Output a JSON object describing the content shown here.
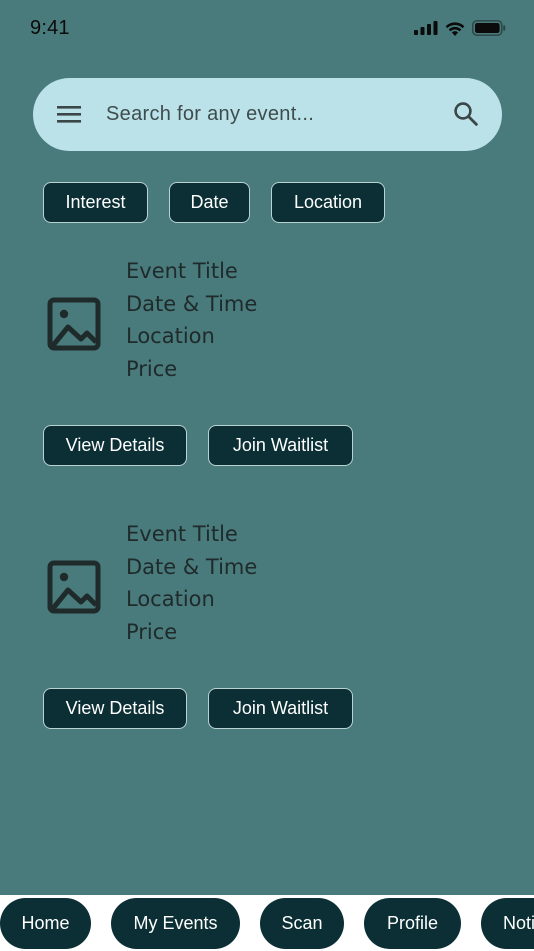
{
  "status_bar": {
    "time": "9:41"
  },
  "search": {
    "placeholder": "Search for any event..."
  },
  "filters": [
    {
      "label": "Interest"
    },
    {
      "label": "Date"
    },
    {
      "label": "Location"
    }
  ],
  "events": [
    {
      "title": "Event Title",
      "datetime": "Date & Time",
      "location": "Location",
      "price": "Price",
      "details_label": "View Details",
      "waitlist_label": "Join Waitlist"
    },
    {
      "title": "Event Title",
      "datetime": "Date & Time",
      "location": "Location",
      "price": "Price",
      "details_label": "View Details",
      "waitlist_label": "Join Waitlist"
    }
  ],
  "bottom_nav": [
    {
      "label": "Home"
    },
    {
      "label": "My Events"
    },
    {
      "label": "Scan"
    },
    {
      "label": "Profile"
    },
    {
      "label": "Notifications"
    }
  ],
  "colors": {
    "background": "#497a7c",
    "search_bar": "#bae2e8",
    "button": "#0b2f34",
    "button_border": "#b9d3d5",
    "nav_background": "#ffffff"
  },
  "icons": {
    "menu": "menu-icon",
    "search": "search-icon",
    "event_image": "image-icon",
    "signal": "cellular-signal-icon",
    "wifi": "wifi-icon",
    "battery": "battery-icon"
  }
}
